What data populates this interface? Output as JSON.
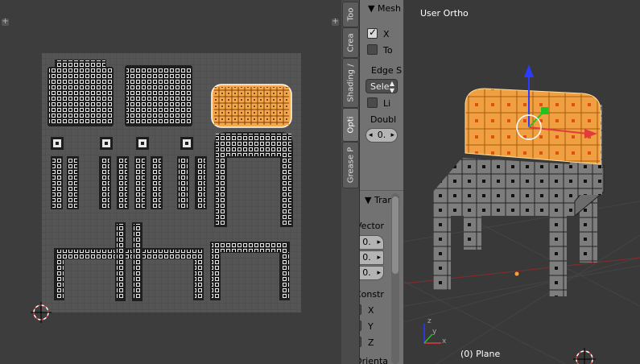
{
  "uv_editor": {
    "grid_bg": "#555555",
    "island_color": "#1e1e1e",
    "selected_color": "#e67e22",
    "plus_icon": "+"
  },
  "side_tabs": [
    {
      "label": "Too",
      "active": false
    },
    {
      "label": "Crea",
      "active": false
    },
    {
      "label": "Shading /",
      "active": false
    },
    {
      "label": "Opti",
      "active": true
    },
    {
      "label": "Grease P",
      "active": false
    }
  ],
  "mesh_panel": {
    "title": "Mesh",
    "x_label": "X",
    "x_checked": true,
    "to_label": "To",
    "to_checked": false,
    "edge_label": "Edge S",
    "edge_select": "Sele",
    "li_label": "Li",
    "li_checked": false,
    "double_label": "Doubl",
    "double_value": "0."
  },
  "translate_panel": {
    "title": "Transl",
    "vector_label": "Vector",
    "vector": [
      "0.",
      "0.",
      "0."
    ],
    "constr_label": "Constr",
    "axes": [
      {
        "label": "X",
        "checked": false
      },
      {
        "label": "Y",
        "checked": false
      },
      {
        "label": "Z",
        "checked": false
      }
    ],
    "orient_label": "Orienta"
  },
  "viewport": {
    "view_label": "User Ortho",
    "object_label": "(0) Plane",
    "axis_labels": {
      "x": "x",
      "y": "y",
      "z": "z"
    },
    "colors": {
      "x_axis": "#e23b3b",
      "y_axis": "#22c222",
      "z_axis": "#2b3bff",
      "selected": "#f0a040",
      "mesh": "#808080"
    }
  }
}
